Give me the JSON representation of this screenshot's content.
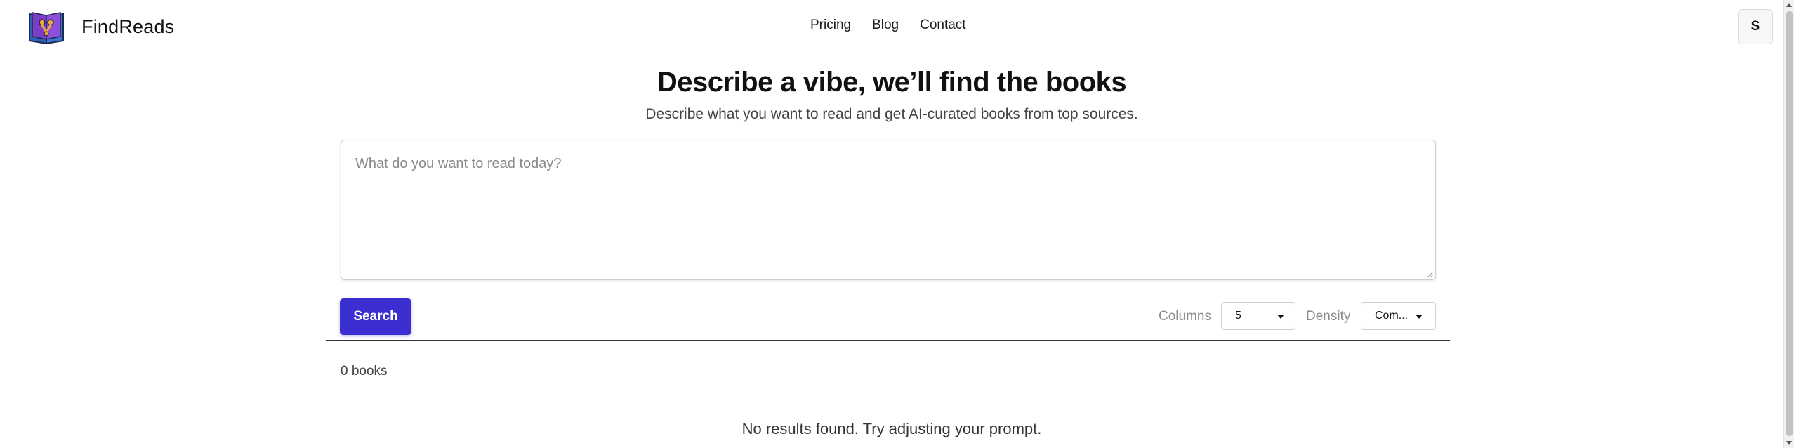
{
  "header": {
    "brand_name": "FindReads",
    "nav": [
      {
        "label": "Pricing"
      },
      {
        "label": "Blog"
      },
      {
        "label": "Contact"
      }
    ],
    "avatar_initial": "S"
  },
  "hero": {
    "title": "Describe a vibe, we’ll find the books",
    "subtitle": "Describe what you want to read and get AI-curated books from top sources."
  },
  "prompt": {
    "placeholder": "What do you want to read today?",
    "value": ""
  },
  "controls": {
    "search_label": "Search",
    "columns_label": "Columns",
    "columns_value": "5",
    "density_label": "Density",
    "density_value": "Com..."
  },
  "results": {
    "count_text": "0 books",
    "empty_message": "No results found. Try adjusting your prompt."
  },
  "colors": {
    "accent": "#3b2fd1",
    "logo_book": "#2f5fb8",
    "logo_cover": "#7a3fc4"
  }
}
